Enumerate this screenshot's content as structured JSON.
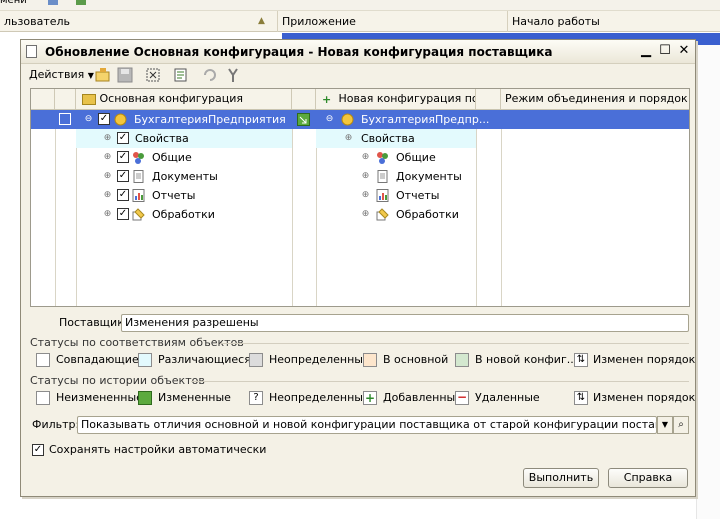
{
  "background": {
    "columns": [
      "льзователь",
      "Приложение",
      "Начало работы"
    ]
  },
  "dialog": {
    "title": "Обновление Основная конфигурация - Новая конфигурация поставщика",
    "toolbar": {
      "actions_label": "Действия"
    },
    "grid": {
      "headers": [
        "Основная конфигурация",
        "Новая конфигурация по...",
        "Режим объединения и порядок п..."
      ],
      "rows": [
        {
          "left": "БухгалтерияПредприятия",
          "right": "БухгалтерияПредпр...",
          "selected": true
        },
        {
          "left": "Свойства",
          "right": "Свойства"
        },
        {
          "left": "Общие",
          "right": "Общие"
        },
        {
          "left": "Документы",
          "right": "Документы"
        },
        {
          "left": "Отчеты",
          "right": "Отчеты"
        },
        {
          "left": "Обработки",
          "right": "Обработки"
        }
      ]
    },
    "supplier": {
      "label": "Поставщик:",
      "value": "Изменения разрешены"
    },
    "status_match": {
      "title": "Статусы по соответствиям объектов",
      "items": [
        {
          "label": "Совпадающие",
          "color": "#ffffff"
        },
        {
          "label": "Различающиеся",
          "color": "#e3fafd"
        },
        {
          "label": "Неопределенные",
          "color": "#dcdcdc"
        },
        {
          "label": "В основной",
          "color": "#fde6cc"
        },
        {
          "label": "В новой конфиг...",
          "color": "#d3e8cf"
        },
        {
          "label": "Изменен порядок",
          "icon": "order-icon"
        }
      ]
    },
    "status_history": {
      "title": "Статусы по истории объектов",
      "items": [
        {
          "label": "Неизмененные",
          "icon": "blank-icon"
        },
        {
          "label": "Измененные",
          "icon": "edit-icon"
        },
        {
          "label": "Неопределенные",
          "icon": "question-icon"
        },
        {
          "label": "Добавленные",
          "icon": "plus-icon"
        },
        {
          "label": "Удаленные",
          "icon": "minus-icon"
        },
        {
          "label": "Изменен порядок",
          "icon": "order-icon"
        }
      ]
    },
    "filter": {
      "label": "Фильтр:",
      "value": "Показывать отличия основной и новой конфигурации поставщика от старой конфигурации поставщика"
    },
    "autosave_label": "Сохранять настройки автоматически",
    "buttons": {
      "run": "Выполнить",
      "help": "Справка"
    }
  }
}
